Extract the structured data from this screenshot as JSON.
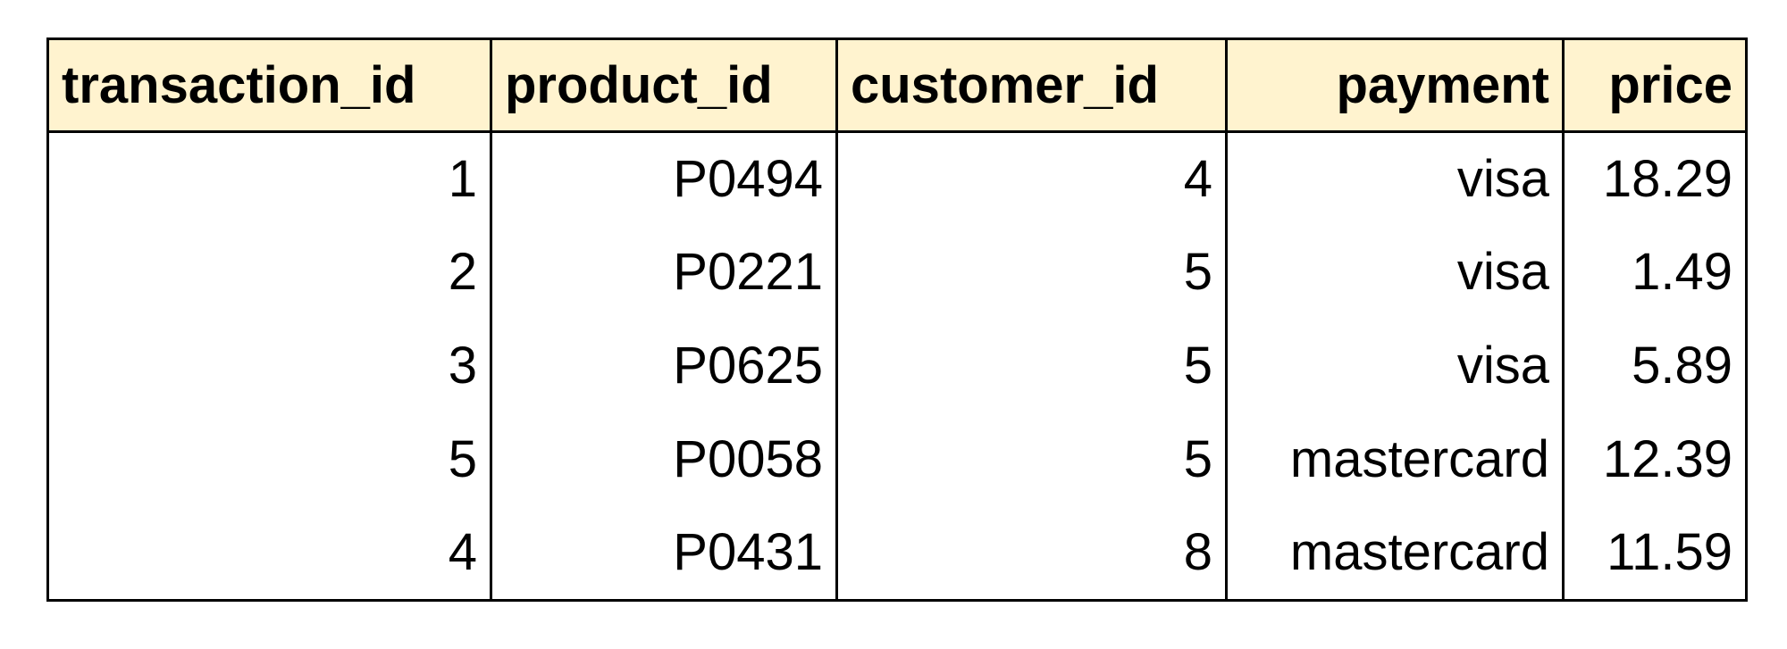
{
  "table": {
    "columns": [
      "transaction_id",
      "product_id",
      "customer_id",
      "payment",
      "price"
    ],
    "rows": [
      [
        "1",
        "P0494",
        "4",
        "visa",
        "18.29"
      ],
      [
        "2",
        "P0221",
        "5",
        "visa",
        "1.49"
      ],
      [
        "3",
        "P0625",
        "5",
        "visa",
        "5.89"
      ],
      [
        "5",
        "P0058",
        "5",
        "mastercard",
        "12.39"
      ],
      [
        "4",
        "P0431",
        "8",
        "mastercard",
        "11.59"
      ]
    ]
  },
  "colors": {
    "header_background": "#fff3cf",
    "border": "#000000",
    "text": "#000000"
  }
}
